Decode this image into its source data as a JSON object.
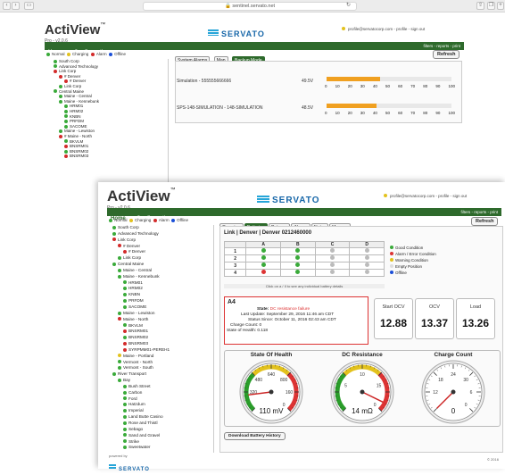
{
  "browser": {
    "url": "sentinel.servato.net"
  },
  "app": {
    "name": "ActiView",
    "tm": "™",
    "version": "Pro - v2.0.6",
    "brand": "SERVATO",
    "profile_links": "profile@servatocorp.com - profile - sign out",
    "nav": [
      "Home",
      "Configuration"
    ],
    "legend": [
      "Normal",
      "Charging",
      "Alarm",
      "Offline"
    ],
    "filter_links": "filters - reports - print",
    "refresh_label": "Refresh"
  },
  "shot1": {
    "tree": [
      "South Corp",
      "Advanced Technology",
      "Link Corp",
      "# Denver",
      "# Denver",
      "Link Corp",
      "Central Maine",
      "Maine - Central",
      "Maine - Kennebunk",
      "HRM01",
      "HRM02",
      "KNBN",
      "PRFDM",
      "SACOME",
      "Maine - Lewiston",
      "# Maine - North",
      "BKVLM",
      "BNSRM01",
      "BNSRM02",
      "BNSRM03"
    ],
    "tabs": [
      "System Alarms",
      "Map",
      "Backup Mode"
    ],
    "rows": [
      {
        "label": "Simulation - 555555666666",
        "volt": "49.5V",
        "fill": 0.43
      },
      {
        "label": "SPS-148-SIMULATION - 148-SIMULATION",
        "volt": "48.5V",
        "fill": 0.4
      }
    ],
    "scale": [
      "0",
      "10",
      "20",
      "30",
      "40",
      "50",
      "60",
      "70",
      "80",
      "90",
      "100"
    ]
  },
  "shot2": {
    "tree": [
      "South Corp",
      "Advanced Technology",
      "Link Corp",
      "# Denver",
      "# Denver",
      "Link Corp",
      "Central Maine",
      "Maine - Central",
      "Maine - Kennebunk",
      "HRM01",
      "HRM02",
      "KNBN",
      "PRFDM",
      "SACOME",
      "Maine - Lewiston",
      "Maine - North",
      "BKVLM",
      "BNSRM01",
      "BNSRM02",
      "BNSRM03",
      "SYRPMM01-PEREH1",
      "Maine - Portland",
      "Vermont - North",
      "Vermont - South",
      "River Transport",
      "Bay",
      "Bush Street",
      "Carbon",
      "Ford",
      "Hatzdum",
      "Imperial",
      "Land Butte Casino",
      "Rose and Thistl",
      "Sebago",
      "Sand and Gravel",
      "Strike",
      "Sweetwater"
    ],
    "tabs": [
      "Overview",
      "Batteries",
      "Outages",
      "Alarms",
      "Notes",
      "Manage"
    ],
    "site_title": "Link | Denver | Denver 0212460000",
    "table_cols": [
      "A",
      "B",
      "C",
      "D"
    ],
    "table_rows": [
      "1",
      "2",
      "3",
      "4"
    ],
    "table_note": "Click on a / II to see any individual battery details",
    "legend": [
      "Good Condition",
      "Alarm / Error Condition",
      "Warning Condition",
      "Empty Position",
      "Offline"
    ],
    "detail": {
      "id": "A4",
      "state_label": "State:",
      "state_value": "DC resistance failure",
      "last_update": "Last Update: September 29, 2016 11:46 am CDT",
      "status_since": "Status Since: October 11, 2016 02:43 am CDT",
      "charge_count": "Charge Count: 0",
      "soh": "State of Health: 0.118"
    },
    "cards": [
      {
        "label": "Start OCV",
        "value": "12.88"
      },
      {
        "label": "OCV",
        "value": "13.37"
      },
      {
        "label": "Load",
        "value": "13.26"
      }
    ],
    "gauges": [
      {
        "title": "State Of Health",
        "readout": "110 mV",
        "ticks": [
          "320",
          "480",
          "640",
          "800",
          "160",
          "0"
        ],
        "value": 0.14
      },
      {
        "title": "DC Resistance",
        "readout": "14 mΩ",
        "ticks": [
          "5",
          "10",
          "15",
          "0"
        ],
        "value": 0.93
      },
      {
        "title": "Charge Count",
        "readout": "0",
        "ticks": [
          "12",
          "18",
          "24",
          "30",
          "6",
          "0"
        ],
        "value": 0.0
      }
    ],
    "download_label": "Download Battery History",
    "footer_left": "powered by",
    "footer_brand": "SERVATO",
    "footer_right": "© 2016"
  }
}
